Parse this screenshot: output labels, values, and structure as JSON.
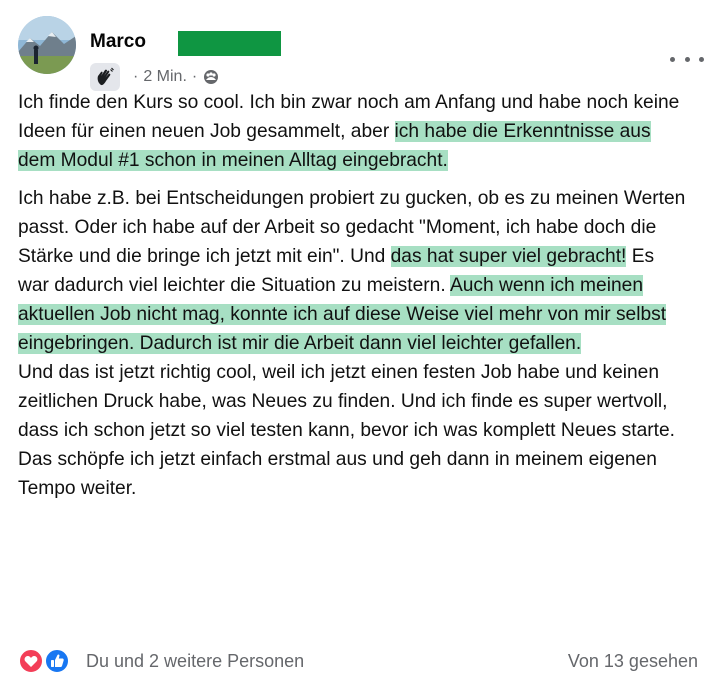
{
  "post": {
    "author": "Marco",
    "time": "2 Min.",
    "separator": "·",
    "paragraph1": [
      {
        "text": "Ich finde den Kurs so cool. Ich bin zwar noch am Anfang und habe noch keine Ideen für einen neuen Job gesammelt, aber ",
        "highlight": false
      },
      {
        "text": "ich habe die Erkenntnisse aus dem Modul #1 schon in meinen Alltag eingebracht.",
        "highlight": true
      }
    ],
    "paragraph2": [
      {
        "text": "Ich habe z.B. bei Entscheidungen probiert zu gucken, ob es zu meinen Werten passt. Oder ich habe auf der Arbeit so gedacht \"Moment, ich habe doch die Stärke und die bringe ich jetzt mit ein\". Und ",
        "highlight": false
      },
      {
        "text": "das hat super viel gebracht!",
        "highlight": true
      },
      {
        "text": " Es war dadurch viel leichter die Situation zu meistern. ",
        "highlight": false
      },
      {
        "text": "Auch wenn ich meinen aktuellen Job nicht mag, konnte ich auf diese Weise viel mehr von mir selbst eingebringen. Dadurch ist mir die Arbeit dann viel leichter gefallen.",
        "highlight": true
      }
    ],
    "paragraph3": "Und das ist jetzt richtig cool, weil ich jetzt einen festen Job habe und keinen zeitlichen Druck habe, was Neues zu finden. Und ich finde es super wertvoll, dass ich schon jetzt so viel testen kann, bevor ich was komplett Neues starte. Das schöpfe ich jetzt einfach erstmal aus und geh dann in meinem eigenen Tempo weiter."
  },
  "footer": {
    "reactions_text": "Du und 2 weitere Personen",
    "seen_text": "Von 13 gesehen"
  },
  "colors": {
    "highlight": "#a7dfc3",
    "redaction": "#0f9642",
    "meta_text": "#65676b",
    "like_blue": "#1877f2",
    "love_red": "#f33e58"
  },
  "icons": [
    "avatar-photo",
    "wave-hand-icon",
    "group-audience-icon",
    "more-options-icon",
    "love-reaction-icon",
    "like-reaction-icon"
  ]
}
